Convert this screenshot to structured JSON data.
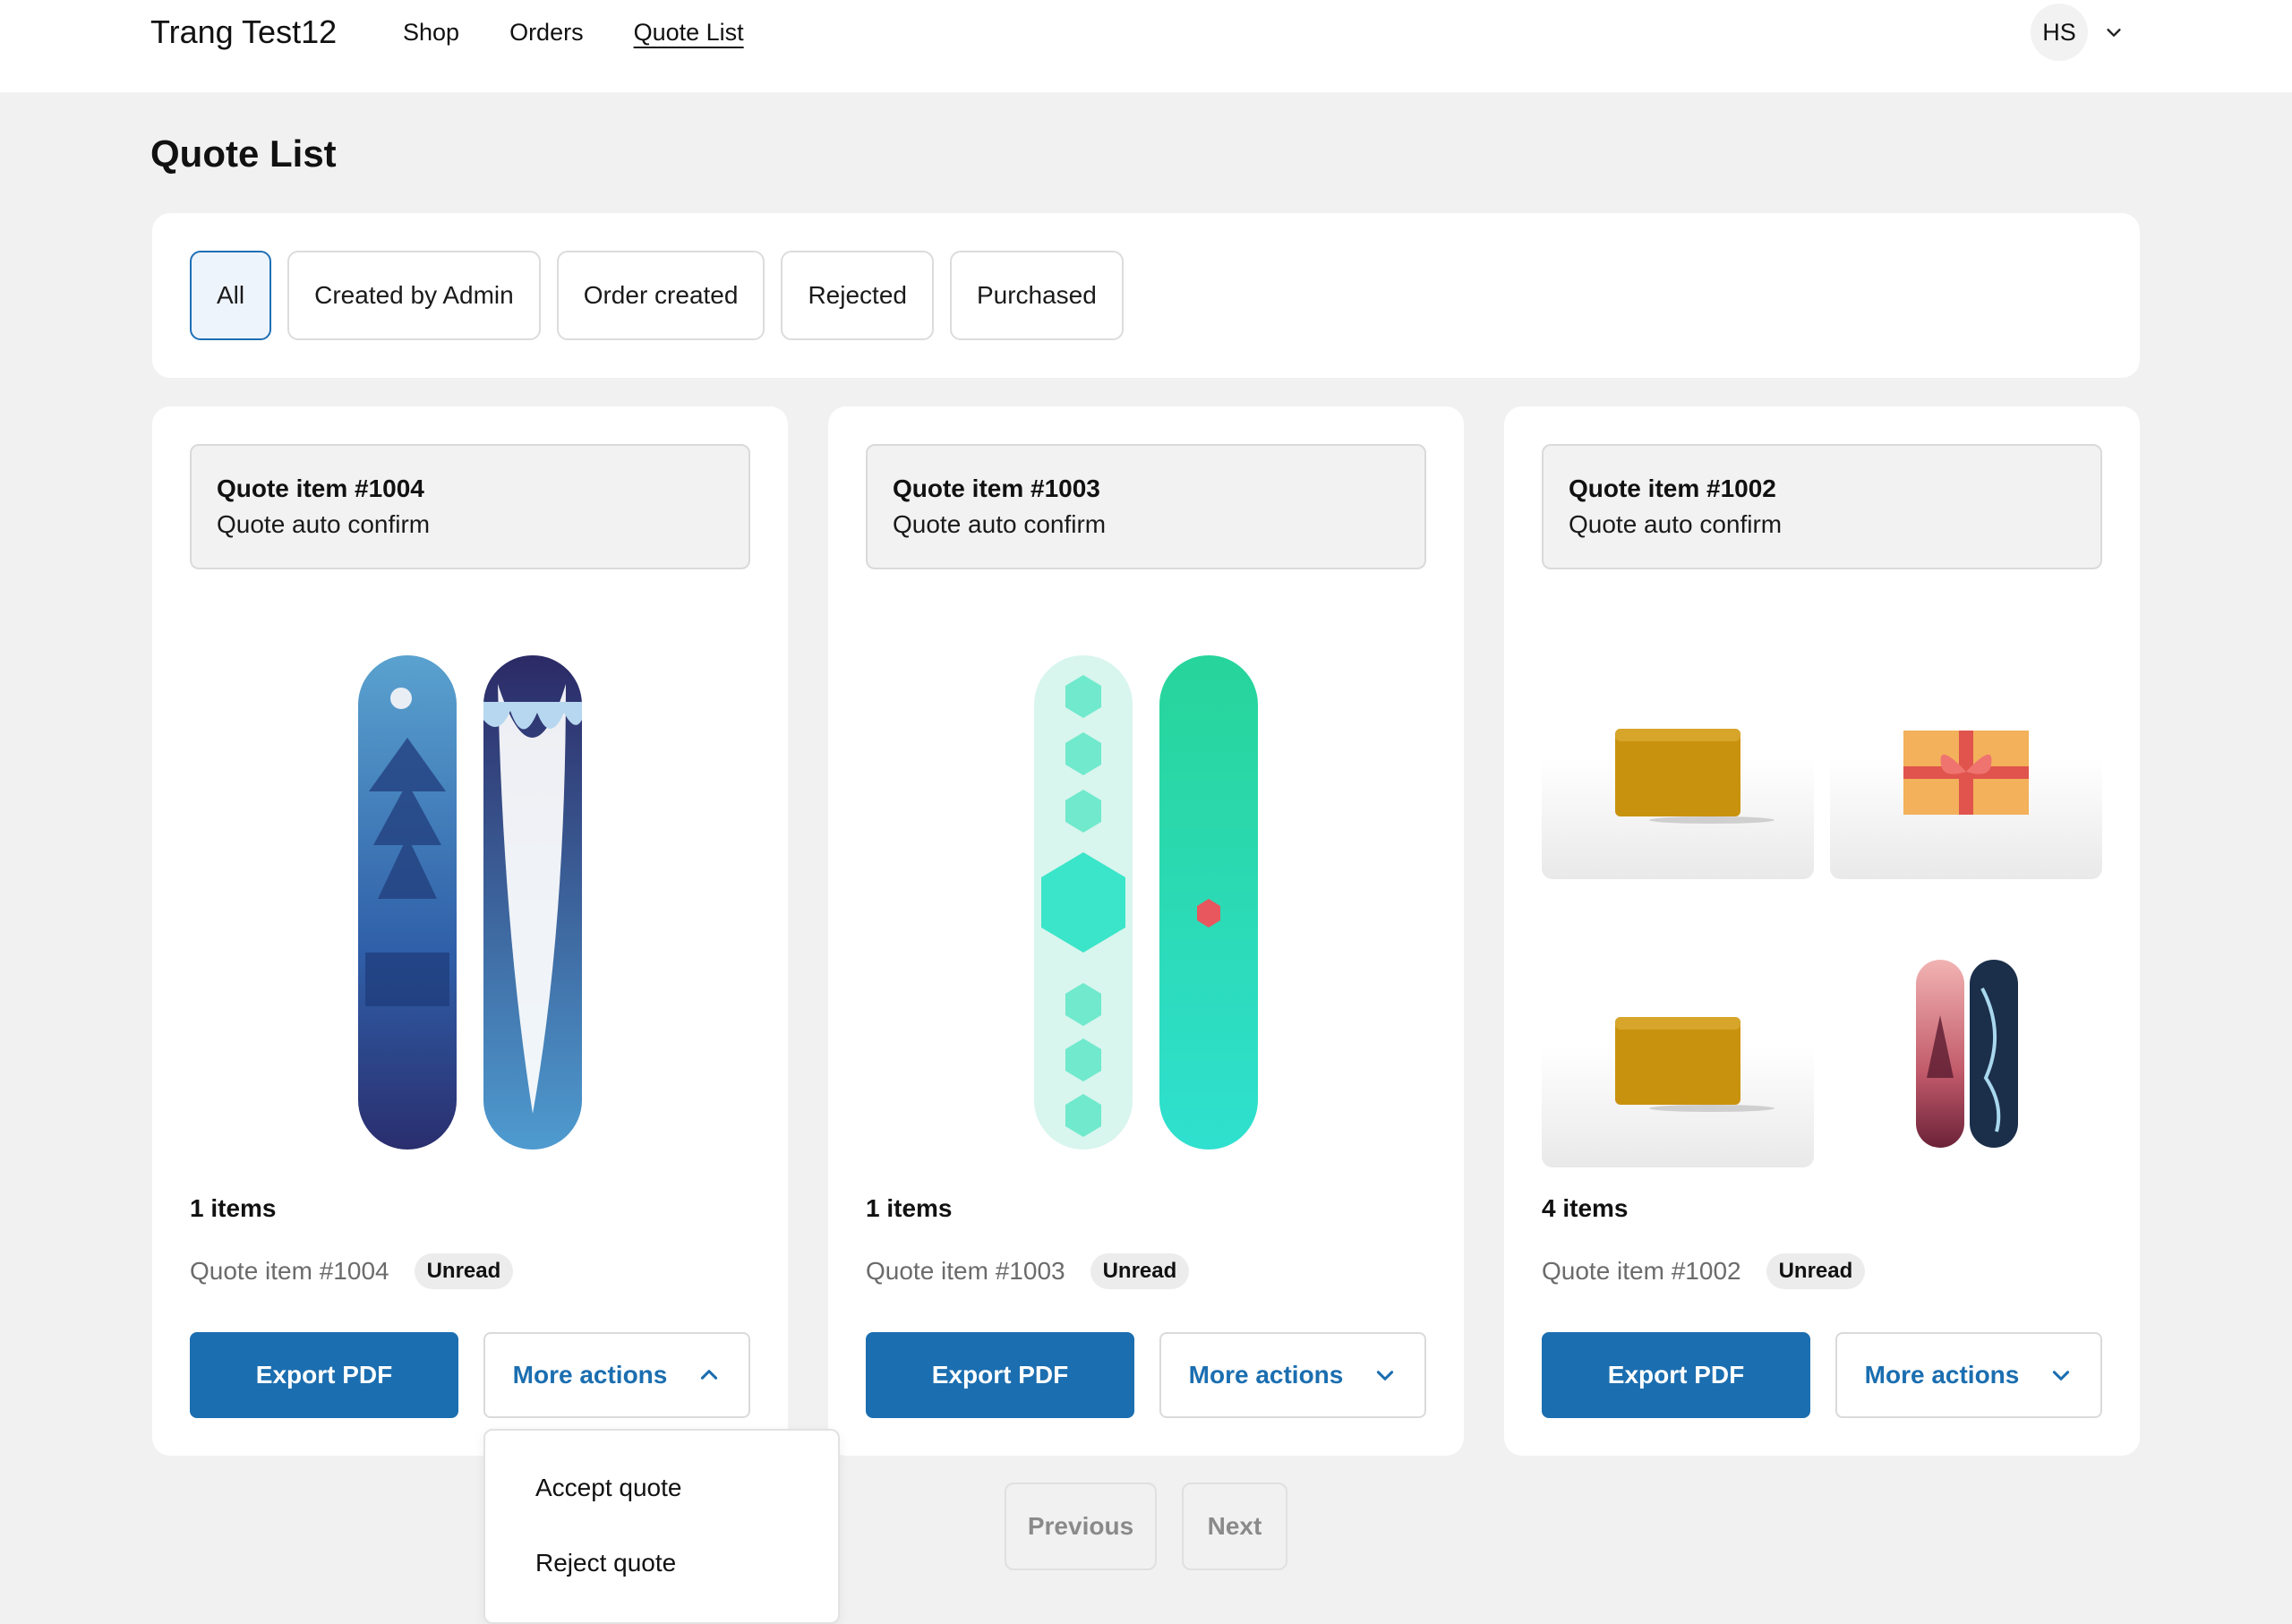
{
  "header": {
    "store_name": "Trang Test12",
    "nav": [
      "Shop",
      "Orders",
      "Quote List"
    ],
    "active_nav": "Quote List",
    "avatar_initials": "HS"
  },
  "page": {
    "title": "Quote List"
  },
  "filters": [
    "All",
    "Created by Admin",
    "Order created",
    "Rejected",
    "Purchased"
  ],
  "active_filter": "All",
  "cards": [
    {
      "title": "Quote item #1004",
      "subtitle": "Quote auto confirm",
      "items_count": "1 items",
      "quote_name": "Quote item #1004",
      "badge": "Unread",
      "export_label": "Export PDF",
      "more_label": "More actions",
      "more_open": true
    },
    {
      "title": "Quote item #1003",
      "subtitle": "Quote auto confirm",
      "items_count": "1 items",
      "quote_name": "Quote item #1003",
      "badge": "Unread",
      "export_label": "Export PDF",
      "more_label": "More actions",
      "more_open": false
    },
    {
      "title": "Quote item #1002",
      "subtitle": "Quote auto confirm",
      "items_count": "4 items",
      "quote_name": "Quote item #1002",
      "badge": "Unread",
      "export_label": "Export PDF",
      "more_label": "More actions",
      "more_open": false
    }
  ],
  "dropdown": {
    "options": [
      "Accept quote",
      "Reject quote"
    ]
  },
  "pagination": {
    "previous": "Previous",
    "next": "Next"
  },
  "colors": {
    "primary": "#1b6eb0",
    "active_filter_bg": "#eef4fc",
    "page_bg": "#f1f1f1"
  },
  "icons": [
    "chevron-down-icon",
    "chevron-up-icon"
  ]
}
